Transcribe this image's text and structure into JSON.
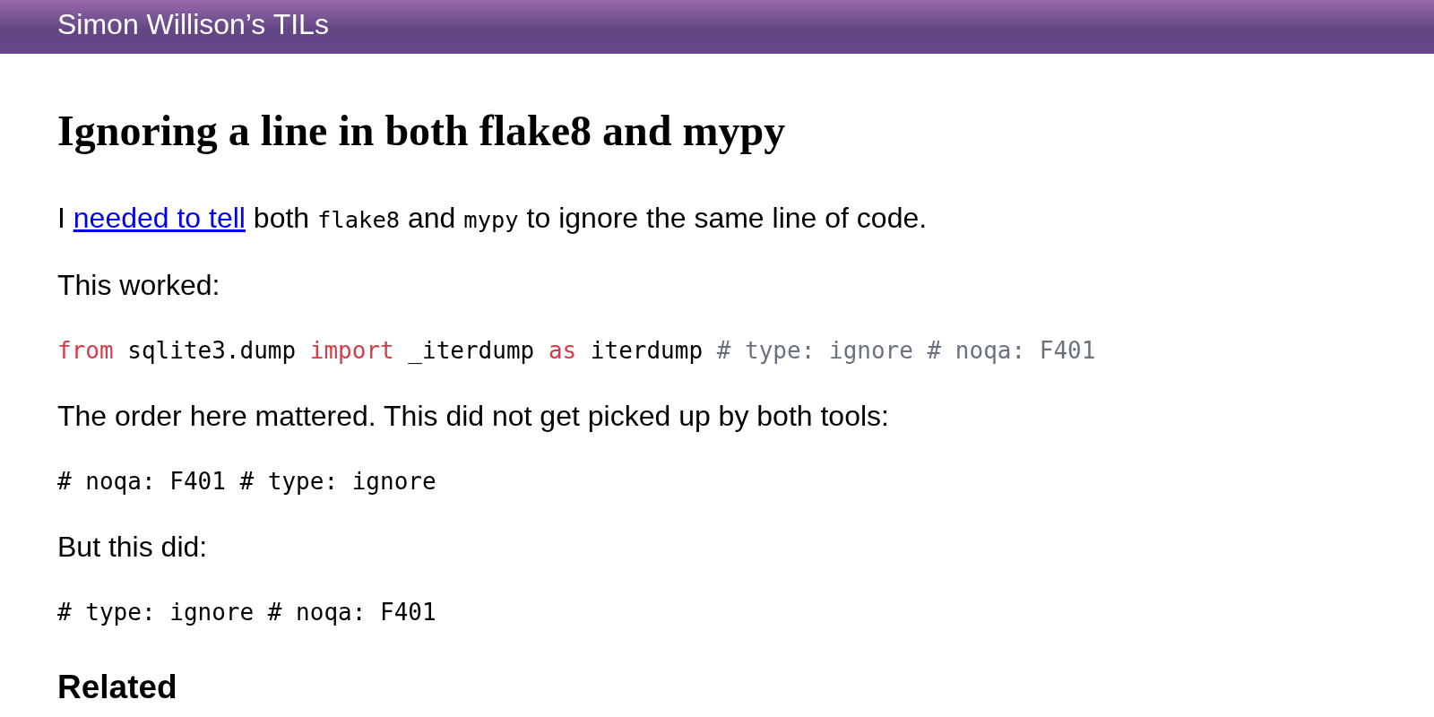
{
  "header": {
    "title": "Simon Willison’s TILs"
  },
  "article": {
    "title": "Ignoring a line in both flake8 and mypy",
    "blocks": [
      {
        "kind": "paragraph",
        "parts": [
          {
            "kind": "text",
            "text": "I "
          },
          {
            "kind": "link",
            "text": "needed to tell"
          },
          {
            "kind": "text",
            "text": " both "
          },
          {
            "kind": "code",
            "text": "flake8"
          },
          {
            "kind": "text",
            "text": " and "
          },
          {
            "kind": "code",
            "text": "mypy"
          },
          {
            "kind": "text",
            "text": " to ignore the same line of code."
          }
        ]
      },
      {
        "kind": "paragraph",
        "parts": [
          {
            "kind": "text",
            "text": "This worked:"
          }
        ]
      },
      {
        "kind": "code_block",
        "tokens": [
          {
            "kind": "keyword",
            "text": "from"
          },
          {
            "kind": "plain",
            "text": " sqlite3.dump "
          },
          {
            "kind": "keyword",
            "text": "import"
          },
          {
            "kind": "plain",
            "text": " _iterdump "
          },
          {
            "kind": "keyword",
            "text": "as"
          },
          {
            "kind": "plain",
            "text": " iterdump "
          },
          {
            "kind": "comment",
            "text": "# type: ignore # noqa: F401"
          }
        ]
      },
      {
        "kind": "paragraph",
        "parts": [
          {
            "kind": "text",
            "text": "The order here mattered. This did not get picked up by both tools:"
          }
        ]
      },
      {
        "kind": "code_block",
        "tokens": [
          {
            "kind": "plain",
            "text": "# noqa: F401 # type: ignore"
          }
        ]
      },
      {
        "kind": "paragraph",
        "parts": [
          {
            "kind": "text",
            "text": "But this did:"
          }
        ]
      },
      {
        "kind": "code_block",
        "tokens": [
          {
            "kind": "plain",
            "text": "# type: ignore # noqa: F401"
          }
        ]
      }
    ]
  },
  "related": {
    "title": "Related"
  }
}
